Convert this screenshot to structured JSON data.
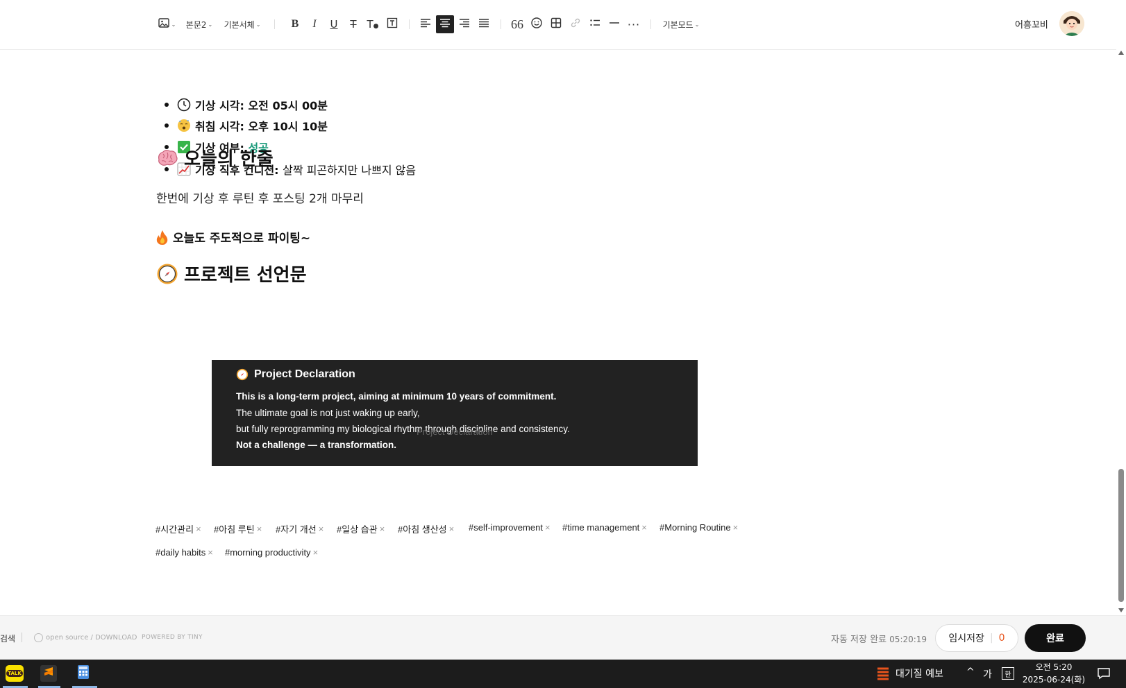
{
  "toolbar": {
    "paragraph_style": "본문2",
    "font_family": "기본서체",
    "mode": "기본모드",
    "user_name": "어흥꼬비"
  },
  "status_list": [
    {
      "icon": "clock-icon",
      "label": "기상 시각:",
      "value": "오전 05시 00분",
      "value_style": "bold"
    },
    {
      "icon": "sleepy-face-icon",
      "label": "취침 시각:",
      "value": "오후 10시 10분",
      "value_style": "bold"
    },
    {
      "icon": "check-mark-icon",
      "label": "기상 여부:",
      "value": "성공",
      "value_style": "green"
    },
    {
      "icon": "chart-increasing-icon",
      "label": "기상 직후 컨디션:",
      "value": "살짝 피곤하지만 나쁘지 않음",
      "value_style": "normal"
    }
  ],
  "section_today": {
    "heading": "오늘의 한줄",
    "icon": "brain-icon",
    "text": "한번에 기상 후 루틴 후 포스팅 2개 마무리",
    "fire_line": "오늘도 주도적으로 파이팅~",
    "fire_icon": "fire-icon"
  },
  "section_project": {
    "heading": "프로젝트 선언문",
    "icon": "compass-icon",
    "image": {
      "title": "Project Declaration",
      "line1": "This is a long-term project, aiming at minimum 10 years of commitment.",
      "line2": "The ultimate goal is not just waking up early,",
      "line3": "but fully reprogramming my biological rhythm through discipline and consistency.",
      "line4": "Not a challenge — a transformation."
    },
    "caption": "Project Declaration"
  },
  "tags": [
    "#시간관리",
    "#아침 루틴",
    "#자기 개선",
    "#일상 습관",
    "#아침 생산성",
    "#self-improvement",
    "#time management",
    "#Morning Routine",
    "#daily habits",
    "#morning productivity"
  ],
  "footer": {
    "left_partial": "검색",
    "open_source": "open source / DOWNLOAD",
    "powered": "POWERED BY TINY",
    "autosave_label": "자동 저장 완료",
    "autosave_time": "05:20:19",
    "draft_label": "임시저장",
    "draft_count": "0",
    "done_label": "완료"
  },
  "taskbar": {
    "app_kakao": "TALK",
    "weather": "대기질 예보",
    "ime": "가",
    "ime2": "한",
    "time": "오전 5:20",
    "date": "2025-06-24(화)"
  },
  "colors": {
    "accent_green": "#1b9a7a",
    "draft_count": "#e8541c",
    "done_button": "#111111",
    "decl_bg": "#222222"
  }
}
